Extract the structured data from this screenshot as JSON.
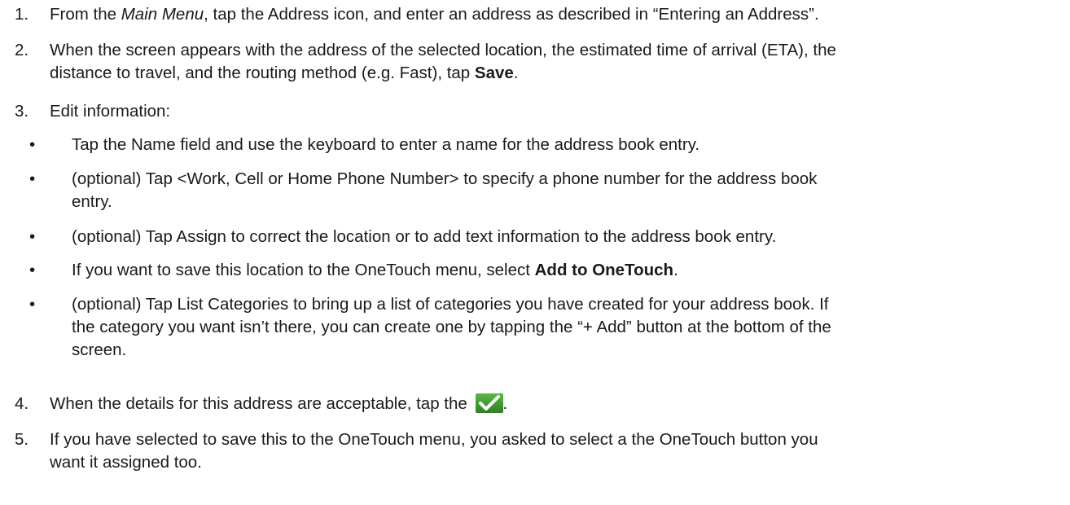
{
  "steps": [
    {
      "num": "1.",
      "pre": "From the ",
      "em": "Main Menu",
      "post": ", tap the Address icon, and enter an address as described in “Entering an Address”."
    },
    {
      "num": "2.",
      "line1": "When the screen appears with the address of the selected location, the estimated time of arrival (ETA), the",
      "line2_pre": "distance to travel, and the routing method (e.g. Fast), tap ",
      "bold": "Save",
      "line2_post": "."
    },
    {
      "num": "3.",
      "text": "Edit information:"
    },
    {
      "num": "4.",
      "pre": "When the details for this address are acceptable, tap the ",
      "post": "."
    },
    {
      "num": "5.",
      "line1": "If you have selected to save this to the OneTouch menu, you asked to select a the OneTouch button you",
      "line2": "want it assigned too."
    }
  ],
  "bullets": [
    {
      "symbol": "•",
      "text": "Tap the Name field and use the keyboard to enter a name for the address book entry."
    },
    {
      "symbol": "•",
      "line1": "(optional) Tap <Work, Cell or Home Phone Number> to specify a phone number for the address book",
      "line2": "entry."
    },
    {
      "symbol": "•",
      "text": "(optional) Tap Assign to correct the location or to add text information to the address book entry."
    },
    {
      "symbol": "•",
      "pre": "If you want to save this location to the OneTouch menu, select ",
      "bold": "Add to OneTouch",
      "post": "."
    },
    {
      "symbol": "•",
      "line1": "(optional) Tap List Categories to bring up a list of categories you have created for your address book.  If",
      "line2": "the category you want isn’t there, you can create one by tapping the “+ Add” button at the bottom of the",
      "line3": "screen."
    }
  ],
  "colors": {
    "text": "#1a1a1a",
    "check_bg": "#3e9b2e",
    "check_mark": "#ffffff"
  },
  "icons": {
    "check": "checkmark-icon"
  }
}
